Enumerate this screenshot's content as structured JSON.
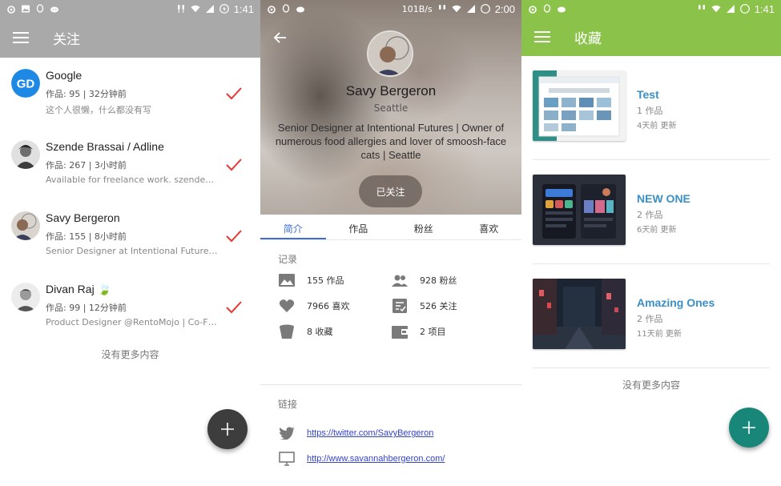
{
  "status": {
    "s1_time": "1:41",
    "s2_speed": "101B/s",
    "s2_time": "2:00",
    "s3_time": "1:41"
  },
  "screen1": {
    "title": "关注",
    "items": [
      {
        "name": "Google",
        "meta": "作品: 95 | 32分钟前",
        "bio": "这个人很懒，什么都没有写",
        "avatar": "GD"
      },
      {
        "name": "Szende Brassai / Adline",
        "meta": "作品: 267 | 3小时前",
        "bio": "Available for freelance work. szende…"
      },
      {
        "name": "Savy Bergeron",
        "meta": "作品: 155 | 8小时前",
        "bio": "Senior Designer at Intentional Future…"
      },
      {
        "name": "Divan Raj 🍃",
        "meta": "作品: 99 | 12分钟前",
        "bio": "Product Designer @RentoMojo | Co-F…"
      }
    ],
    "no_more": "没有更多内容"
  },
  "screen2": {
    "name": "Savy Bergeron",
    "location": "Seattle",
    "bio": "Senior Designer at Intentional Futures | Owner of numerous food allergies and lover of smoosh-face cats | Seattle",
    "followed_button": "已关注",
    "tabs": [
      "简介",
      "作品",
      "粉丝",
      "喜欢"
    ],
    "record_title": "记录",
    "stats": [
      {
        "icon": "image-icon",
        "label": "155 作品"
      },
      {
        "icon": "people-icon",
        "label": "928 粉丝"
      },
      {
        "icon": "heart-icon",
        "label": "7966 喜欢"
      },
      {
        "icon": "following-icon",
        "label": "526 关注"
      },
      {
        "icon": "bucket-icon",
        "label": "8 收藏"
      },
      {
        "icon": "wallet-icon",
        "label": "2 项目"
      }
    ],
    "links_title": "链接",
    "links": [
      {
        "icon": "twitter-icon",
        "url": "https://twitter.com/SavyBergeron"
      },
      {
        "icon": "monitor-icon",
        "url": "http://www.savannahbergeron.com/"
      }
    ]
  },
  "screen3": {
    "title": "收藏",
    "collections": [
      {
        "title": "Test",
        "count": "1 作品",
        "updated": "4天前 更新"
      },
      {
        "title": "NEW ONE",
        "count": "2 作品",
        "updated": "6天前 更新"
      },
      {
        "title": "Amazing Ones",
        "count": "2 作品",
        "updated": "11天前 更新"
      }
    ],
    "no_more": "没有更多内容"
  },
  "colors": {
    "grey_appbar": "#a9a9a9",
    "green_appbar": "#8bc34a",
    "tab_accent": "#3f6fd6",
    "check_red": "#e53935",
    "fab_dark": "#3d3d3d",
    "fab_teal": "#18877a",
    "collection_title": "#3a8fc4"
  }
}
